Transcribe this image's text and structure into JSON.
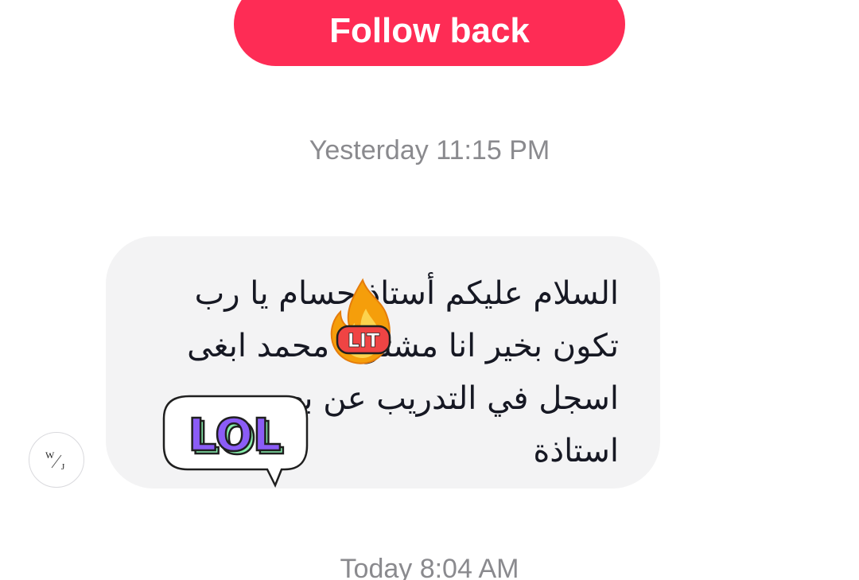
{
  "header": {
    "follow_back_label": "Follow back"
  },
  "timestamps": {
    "yesterday": "Yesterday 11:15 PM",
    "today": "Today 8:04 AM"
  },
  "message": {
    "text": "السلام عليكم أستاذ حسام   يا رب تكون بخير انا مشترك محمد  ابغى اسجل في التدريب عن بعد مع استاذة",
    "sender_avatar_monogram_top": "W",
    "sender_avatar_monogram_bottom": "J"
  },
  "stickers": {
    "lit": {
      "text": "LIT",
      "icon": "fire-icon"
    },
    "lol": {
      "text": "LOL",
      "icon": "speech-bubble-icon"
    }
  },
  "colors": {
    "accent": "#fe2c55",
    "bubble": "#f3f3f4",
    "timestamp": "#8a8a8e",
    "message_text": "#161823",
    "lol_fill": "#8b5cf6",
    "lol_shadow": "#86efac",
    "fire_outer": "#f59e0b",
    "fire_inner": "#fcd34d",
    "lit_badge": "#ef4444"
  }
}
